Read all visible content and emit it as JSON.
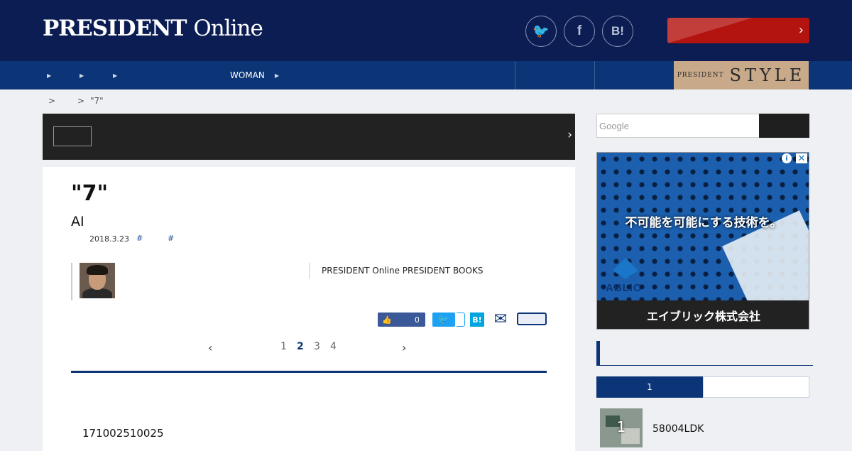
{
  "header": {
    "logo_main": "PRESIDENT",
    "logo_light": "Online",
    "social": [
      {
        "icon": "twitter-icon",
        "glyph": "🐦",
        "label": ""
      },
      {
        "icon": "facebook-icon",
        "glyph": "f",
        "label": ""
      },
      {
        "icon": "hatena-bookmark-icon",
        "glyph": "B!",
        "label": ""
      }
    ],
    "cta_label": "",
    "cta_chevron": "›"
  },
  "nav": {
    "items": [
      "",
      "",
      "",
      "",
      "",
      "WOMAN",
      ""
    ],
    "style_small": "PRESIDENT",
    "style_big": "STYLE"
  },
  "breadcrumb": {
    "sep1": ">",
    "sep2": ">",
    "current": "\"7\""
  },
  "darkbar": {
    "chevron": "›"
  },
  "article": {
    "title": "\"7\"",
    "subtitle": "AI",
    "date": "2018.3.23",
    "tags": [
      "#",
      "#"
    ],
    "book_info": "PRESIDENT Online PRESIDENT BOOKS",
    "share": {
      "fb_count": "0",
      "tw_glyph": "🐦",
      "hb_glyph": "B!",
      "mail_glyph": "✉"
    },
    "pager": {
      "prev": "‹",
      "pages": [
        "1",
        "2",
        "3",
        "4"
      ],
      "current": "2",
      "next": "›"
    },
    "body_first": "171002510025"
  },
  "sidebar": {
    "search_placeholder": "Google",
    "ad": {
      "headline": "不可能を可能にする技術を。",
      "brand": "ABLIC",
      "company": "エイブリック株式会社",
      "info_glyph": "i",
      "close_glyph": "✕"
    },
    "ranking": {
      "tab_active": "1",
      "item_rank": "1",
      "item_text": "58004LDK"
    }
  },
  "colors": {
    "header_bg": "#0b1d52",
    "nav_bg": "#0b3576",
    "cta_red": "#b4140f",
    "style_gold": "#c8a98a"
  }
}
